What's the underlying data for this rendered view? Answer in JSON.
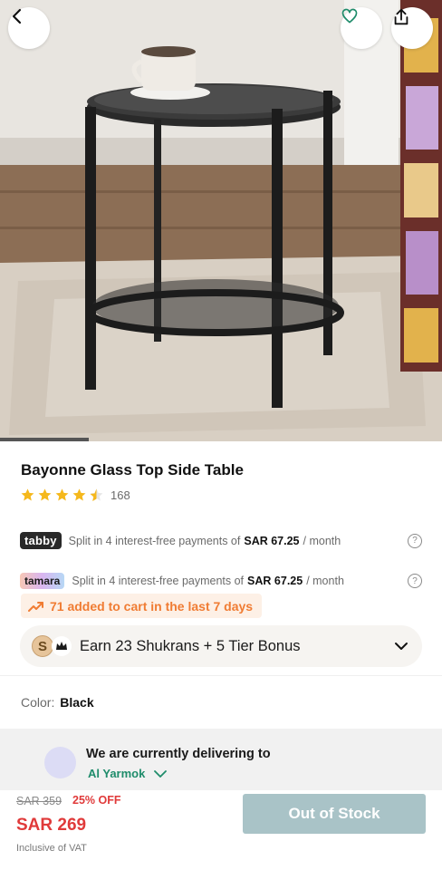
{
  "product": {
    "title": "Bayonne Glass Top Side Table",
    "rating": 4.5,
    "rating_count": "168",
    "color_label": "Color:",
    "color_value": "Black"
  },
  "payments": {
    "tabby": {
      "badge": "tabby",
      "text": "Split in 4 interest-free payments of",
      "amount": "SAR 67.25",
      "period": "/ month",
      "help": "?"
    },
    "tamara": {
      "badge": "tamara",
      "text": "Split in 4 interest-free payments of",
      "amount": "SAR 67.25",
      "period": "/ month",
      "help": "?"
    }
  },
  "cart_activity": "71 added to cart in the last 7 days",
  "shukran": {
    "coin_letter": "S",
    "text": "Earn 23 Shukrans + 5 Tier Bonus"
  },
  "delivery": {
    "title": "We are currently delivering to",
    "location": "Al Yarmok"
  },
  "pricing": {
    "old_price": "SAR 359",
    "discount": "25% OFF",
    "price": "SAR 269",
    "vat_note": "Inclusive of VAT"
  },
  "actions": {
    "out_of_stock_label": "Out of Stock"
  },
  "gallery": {
    "progress_fraction": 0.2
  },
  "icons": {
    "back": "chevron-left-icon",
    "favorite": "heart-icon",
    "share": "share-icon",
    "star": "star-icon",
    "trend": "trending-up-icon",
    "crown": "crown-icon",
    "chevron": "chevron-down-icon"
  },
  "colors": {
    "accent_green": "#1f8c6b",
    "sale_red": "#e03a3a",
    "star_gold": "#f5b81c",
    "activity_orange": "#f07c33",
    "disabled_button": "#a9c3c7"
  }
}
